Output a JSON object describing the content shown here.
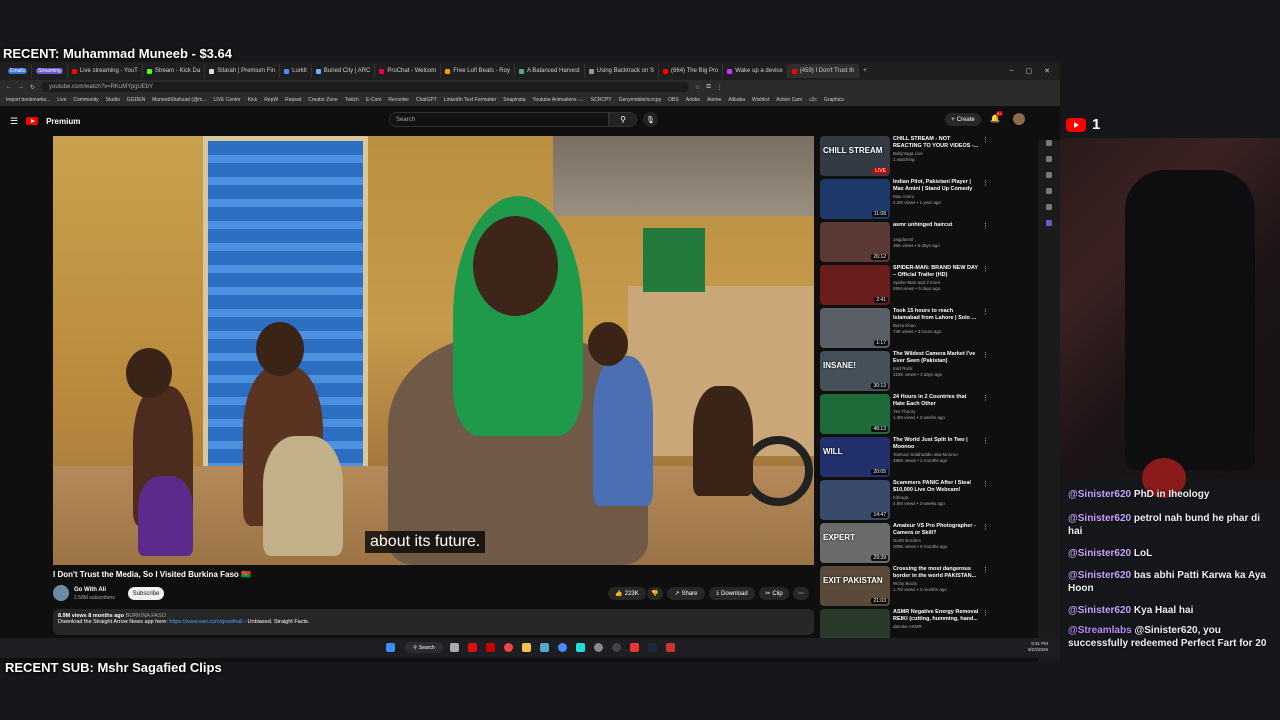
{
  "overlay": {
    "recent_donation": "RECENT: Muhammad Muneeb - $3.64",
    "recent_sub": "RECENT SUB: Mshr Sagafied Clips",
    "youtube_viewer_count": "1"
  },
  "browser": {
    "tabs": [
      {
        "label": "Emails",
        "pill": true
      },
      {
        "label": "Streaming",
        "pill": true
      },
      {
        "label": "Live streaming - YouT"
      },
      {
        "label": "Stream - Kick Da"
      },
      {
        "label": "Sitarah | Premium Fin"
      },
      {
        "label": "Lurkit"
      },
      {
        "label": "Buried City | ARC"
      },
      {
        "label": "ProChat - Welcom"
      },
      {
        "label": "Free Lofi Beats - Roy"
      },
      {
        "label": "A Balanced Harvest"
      },
      {
        "label": "Using Backtrack on S"
      },
      {
        "label": "(664) The Big Pro"
      },
      {
        "label": "Wake up a device"
      },
      {
        "label": "(459) I Don't Trust th"
      }
    ],
    "url": "youtube.com/watch?v=RKuMYpgUEbY",
    "bookmarks": [
      "Import bookmarks...",
      "Live",
      "Community",
      "Studio",
      "GGDEN",
      "MuneebShahzad (@m...",
      "LIVE Center",
      "Kick",
      "RepW",
      "Repeat",
      "Creator Zone",
      "Twitch",
      "E-Com",
      "Recorder",
      "ChatGPT",
      "LinkedIn Text Formatter",
      "Snapinsta",
      "Youtube Animations -...",
      "SCRCPY",
      "Genymobile/scrcpy",
      "OBS",
      "Adobe",
      "Anime",
      "Alibaba",
      "Wishlist",
      "Action Cam",
      "c2c",
      "Graphics"
    ]
  },
  "youtube": {
    "logo_label": "Premium",
    "search_placeholder": "Search",
    "create_label": "Create",
    "notification_count": "9+",
    "subtitle": "about its future.",
    "title": "I Don't Trust the Media, So I Visited Burkina Faso 🇧🇫",
    "channel": {
      "name": "Go With Ali",
      "subs": "1.58M subscribers"
    },
    "subscribe_label": "Subscribe",
    "actions": {
      "likes": "223K",
      "share": "Share",
      "download": "Download",
      "clip": "Clip"
    },
    "description": {
      "meta": "8.9M views  8 months ago",
      "hashtag": "BURKINA FASO",
      "text": "Download the Straight Arrow News app here: ",
      "link": "https://www.san.com/gowithali",
      "tail": " - Unbiased. Straight Facts."
    },
    "recommendations": [
      {
        "title": "CHILL STREAM - NOT REACTING TO YOUR VIDEOS -...",
        "channel": "BabyYaga Live",
        "views": "1 watching",
        "badge": "LIVE",
        "thumb_text": "CHILL STREAM",
        "color": "#333a44"
      },
      {
        "title": "Indian Pilot, Pakistani Player | Max Amini | Stand Up Comedy",
        "channel": "Max Amini",
        "views": "2.2M views • 1 year ago",
        "badge": "11:08",
        "thumb_text": "",
        "color": "#1d3a6b"
      },
      {
        "title": "asmr unhinged haircut",
        "channel": "zaqplasmf",
        "views": "35K views • 6 days ago",
        "badge": "26:12",
        "thumb_text": "",
        "color": "#5a3a32"
      },
      {
        "title": "SPIDER-MAN: BRAND NEW DAY – Official Trailer (HD)",
        "channel": "Spider-Man and 3 more",
        "views": "26M views • 5 days ago",
        "badge": "2:41",
        "thumb_text": "",
        "color": "#6b1c1c"
      },
      {
        "title": "Took 15 hours to reach Islamabad from Lahore | Solo ...",
        "channel": "Barra Khan",
        "views": "74K views • 3 hours ago",
        "badge": "1:17",
        "thumb_text": "",
        "color": "#5a5e66"
      },
      {
        "title": "The Wildest Camera Market I've Ever Seen (Pakistan)",
        "channel": "Karl Rock",
        "views": "218K views • 3 days ago",
        "badge": "30:13",
        "thumb_text": "INSANE!",
        "color": "#45505a"
      },
      {
        "title": "24 Hours in 2 Countries that Hate Each Other",
        "channel": "Yes Theory",
        "views": "1.3M views • 3 weeks ago",
        "badge": "48:13",
        "thumb_text": "",
        "color": "#1e6b3a"
      },
      {
        "title": "The World Just Split In Two | Moonoo",
        "channel": "Taimoor Salahuddin aka Mooroo",
        "views": "486K views • 2 months ago",
        "badge": "20:05",
        "thumb_text": "WILL",
        "color": "#22306b"
      },
      {
        "title": "Scammers PANIC After I Steal $10,000 Live On Webcam!",
        "channel": "Kitboga",
        "views": "4.8M views • 3 weeks ago",
        "badge": "14:47",
        "thumb_text": "",
        "color": "#3a4a6b"
      },
      {
        "title": "Amateur VS Pro Photographer - Camera or Skill?",
        "channel": "North Borders",
        "views": "205K views • 6 months ago",
        "badge": "29:39",
        "thumb_text": "EXPERT",
        "color": "#6b6b6b"
      },
      {
        "title": "Crossing the most dangerous border in the world  PAKISTAN...",
        "channel": "Richy Boots",
        "views": "1.7M views • 3 months ago",
        "badge": "21:03",
        "thumb_text": "EXIT PAKISTAN",
        "color": "#5a4a3a"
      },
      {
        "title": "ASMR Negative Energy Removal REIKI (cutting, humming, hand...",
        "channel": "danoke ASMR",
        "views": "",
        "badge": "",
        "thumb_text": "",
        "color": "#2a3a2a"
      }
    ]
  },
  "taskbar": {
    "search_label": "Search",
    "time": "9:31 PM",
    "date": "9/23/2026"
  },
  "chat": [
    {
      "user": "@Sinister620",
      "text": "PhD in Iheology"
    },
    {
      "user": "@Sinister620",
      "text": "petrol nah bund he phar di hai"
    },
    {
      "user": "@Sinister620",
      "text": "LoL"
    },
    {
      "user": "@Sinister620",
      "text": "bas abhi Patti Karwa ka Aya Hoon"
    },
    {
      "user": "@Sinister620",
      "text": "Kya Haal hai"
    },
    {
      "user": "@Streamlabs",
      "text": "@Sinister620, you successfully redeemed Perfect Fart for 20"
    }
  ],
  "colors": {
    "accent": "#ff0000",
    "chat_user": "#c9a5ff",
    "link": "#3ea6ff"
  }
}
